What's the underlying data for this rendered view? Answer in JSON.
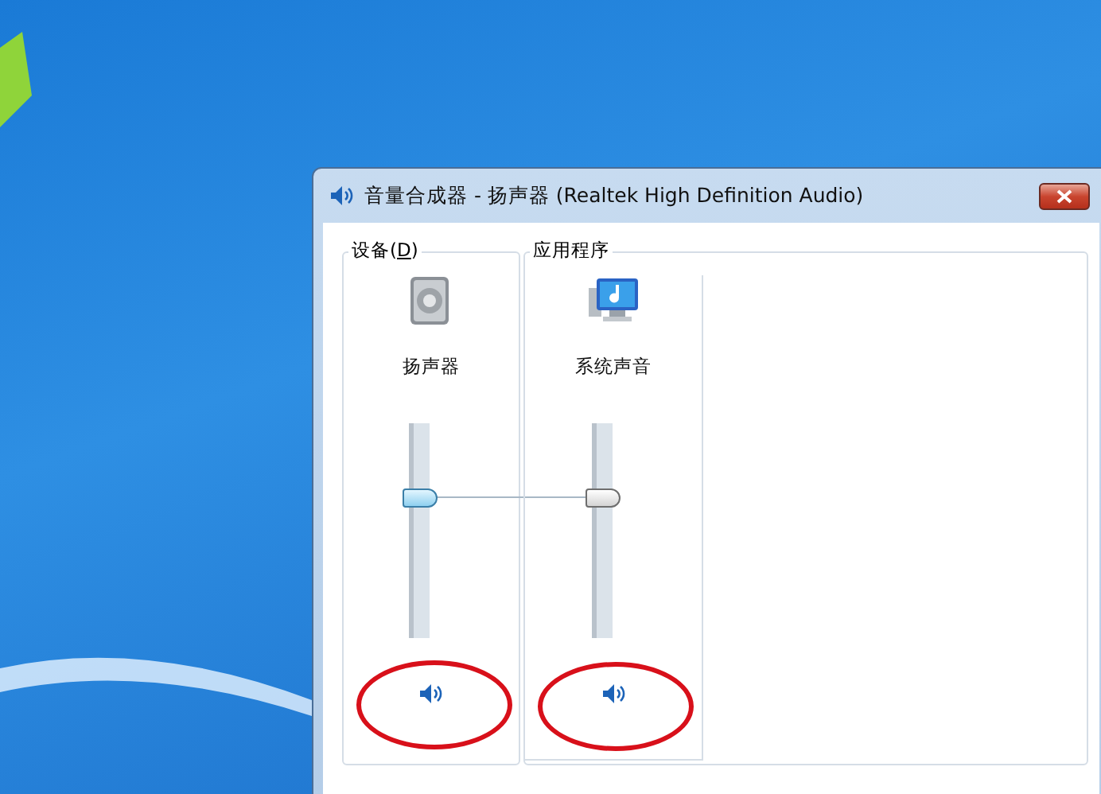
{
  "window": {
    "title": "音量合成器 - 扬声器 (Realtek High Definition Audio)"
  },
  "groups": [
    {
      "label_parts": [
        {
          "text": "设备(",
          "underlined": false
        },
        {
          "text": "D",
          "underlined": true
        },
        {
          "text": ")",
          "underlined": false
        }
      ],
      "kind": "device",
      "channels": [
        {
          "name": "扬声器",
          "level": 0.65,
          "focused": true,
          "muted": false,
          "circled": true
        }
      ]
    },
    {
      "label_parts": [
        {
          "text": "应用程序",
          "underlined": false
        }
      ],
      "kind": "apps",
      "channels": [
        {
          "name": "系统声音",
          "level": 0.65,
          "focused": false,
          "muted": false,
          "circled": true
        }
      ]
    }
  ]
}
